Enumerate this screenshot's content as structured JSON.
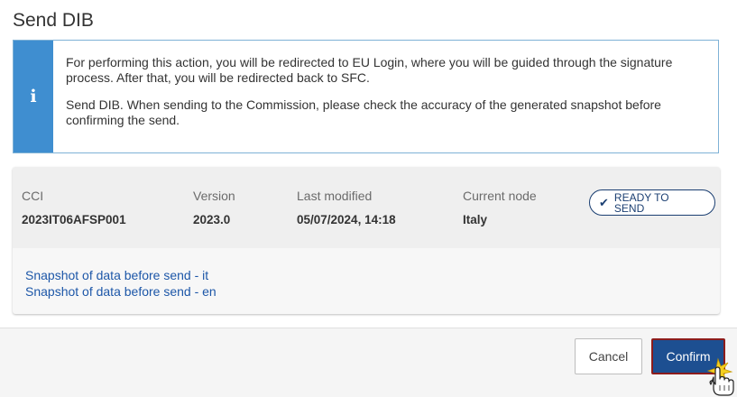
{
  "dialog": {
    "title": "Send DIB"
  },
  "info": {
    "icon": "info-icon",
    "line1": "For performing this action, you will be redirected to EU Login, where you will be guided through the signature process. After that, you will be redirected back to SFC.",
    "line2": "Send DIB. When sending to the Commission, please check the accuracy of the generated snapshot before confirming the send."
  },
  "record": {
    "cci_label": "CCI",
    "cci_value": "2023IT06AFSP001",
    "version_label": "Version",
    "version_value": "2023.0",
    "modified_label": "Last modified",
    "modified_value": "05/07/2024, 14:18",
    "node_label": "Current node",
    "node_value": "Italy",
    "status": "READY TO SEND",
    "status_icon": "check-icon"
  },
  "snapshots": [
    "Snapshot of data before send - it",
    "Snapshot of data before send - en"
  ],
  "buttons": {
    "cancel": "Cancel",
    "confirm": "Confirm"
  },
  "colors": {
    "info_bar": "#3f8ed0",
    "primary": "#1d4f91",
    "link": "#1d57a8",
    "badge": "#1b3f72"
  }
}
